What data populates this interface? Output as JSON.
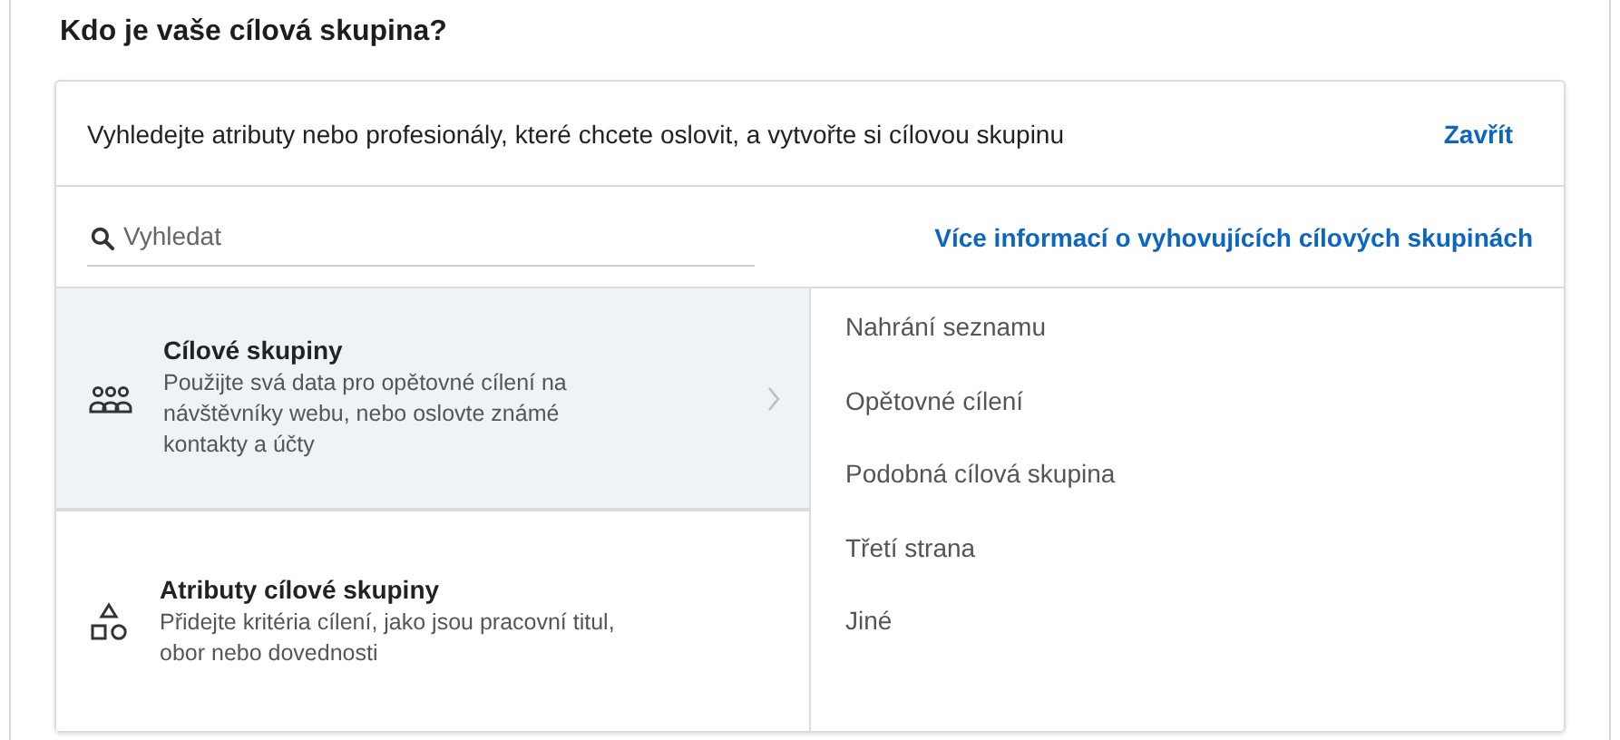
{
  "heading": "Kdo je vaše cílová skupina?",
  "intro": {
    "text": "Vyhledejte atributy nebo profesionály, které chcete oslovit, a vytvořte si cílovou skupinu",
    "close_link": "Zavřít"
  },
  "search": {
    "placeholder": "Vyhledat",
    "info_link": "Více informací o vyhovujících cílových skupinách"
  },
  "categories": [
    {
      "kind": "people",
      "title": "Cílové skupiny",
      "description": "Použijte svá data pro opětovné cílení na návštěvníky webu, nebo oslovte známé kontakty a účty",
      "selected": true
    },
    {
      "kind": "shapes",
      "title": "Atributy cílové skupiny",
      "description": "Přidejte kritéria cílení, jako jsou pracovní titul, obor nebo dovednosti",
      "selected": false
    }
  ],
  "options": [
    "Nahrání seznamu",
    "Opětovné cílení",
    "Podobná cílová skupina",
    "Třetí strana",
    "Jiné"
  ]
}
